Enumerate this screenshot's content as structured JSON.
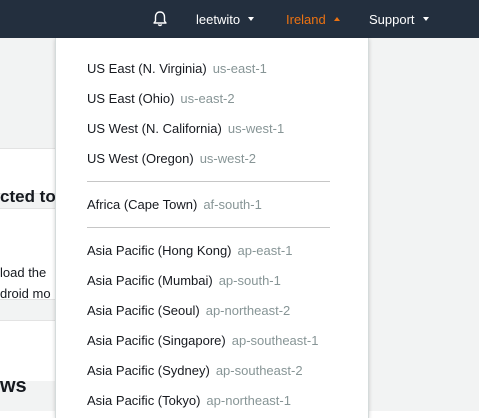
{
  "topbar": {
    "username": "leetwito",
    "region": "Ireland",
    "support": "Support"
  },
  "background": {
    "heading1": "cted to",
    "text1": "load the",
    "text2": "droid mo",
    "heading2": "ws"
  },
  "regions": {
    "group1": [
      {
        "name": "US East (N. Virginia)",
        "code": "us-east-1"
      },
      {
        "name": "US East (Ohio)",
        "code": "us-east-2"
      },
      {
        "name": "US West (N. California)",
        "code": "us-west-1"
      },
      {
        "name": "US West (Oregon)",
        "code": "us-west-2"
      }
    ],
    "group2": [
      {
        "name": "Africa (Cape Town)",
        "code": "af-south-1"
      }
    ],
    "group3": [
      {
        "name": "Asia Pacific (Hong Kong)",
        "code": "ap-east-1"
      },
      {
        "name": "Asia Pacific (Mumbai)",
        "code": "ap-south-1"
      },
      {
        "name": "Asia Pacific (Seoul)",
        "code": "ap-northeast-2"
      },
      {
        "name": "Asia Pacific (Singapore)",
        "code": "ap-southeast-1"
      },
      {
        "name": "Asia Pacific (Sydney)",
        "code": "ap-southeast-2"
      },
      {
        "name": "Asia Pacific (Tokyo)",
        "code": "ap-northeast-1"
      }
    ]
  }
}
